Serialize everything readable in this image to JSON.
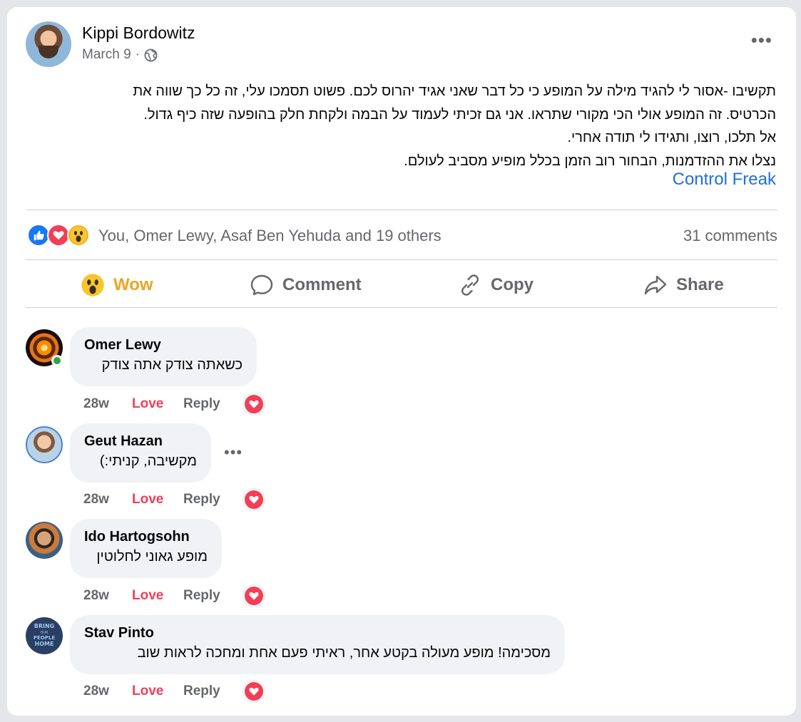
{
  "post": {
    "author": "Kippi Bordowitz",
    "date": "March 9",
    "separator": "·",
    "lines": [
      "תקשיבו -אסור לי להגיד מילה על המופע כי כל דבר שאני אגיד יהרוס לכם. פשוט תסמכו עלי, זה כל כך שווה את",
      "הכרטיס. זה המופע אולי הכי מקורי שתראו. אני גם זכיתי לעמוד על הבמה ולקחת חלק בהופעה שזה כיף גדול.",
      "אל תלכו, רוצו, ותגידו לי תודה אחרי.",
      "נצלו את ההזדמנות, הבחור רוב הזמן בכלל מופיע מסביב לעולם."
    ],
    "link_text": "Control Freak"
  },
  "reactions": {
    "summary": "You, Omer Lewy, Asaf Ben Yehuda and 19 others",
    "comments_count": "31 comments"
  },
  "actions": {
    "wow": "Wow",
    "comment": "Comment",
    "copy": "Copy",
    "share": "Share"
  },
  "comments": [
    {
      "name": "Omer Lewy",
      "text": "כשאתה צודק אתה צודק",
      "time": "28w",
      "love": "Love",
      "reply": "Reply"
    },
    {
      "name": "Geut Hazan",
      "text": "מקשיבה, קניתי:)",
      "time": "28w",
      "love": "Love",
      "reply": "Reply"
    },
    {
      "name": "Ido Hartogsohn",
      "text": "מופע גאוני לחלוטין",
      "time": "28w",
      "love": "Love",
      "reply": "Reply"
    },
    {
      "name": "Stav Pinto",
      "text": "מסכימה! מופע מעולה בקטע אחר, ראיתי פעם אחת ומחכה לראות שוב",
      "time": "28w",
      "love": "Love",
      "reply": "Reply"
    }
  ],
  "avatar_texts": {
    "stav": [
      "BRING",
      "OUR",
      "PEOPLE",
      "HOME"
    ]
  },
  "colors": {
    "link": "#216fdb",
    "wow_active": "#e9a524",
    "love": "#f33e58",
    "like": "#1877f2",
    "secondary_text": "#65676b",
    "bubble": "#f0f2f5"
  },
  "icons": [
    "globe-icon",
    "more-icon",
    "like-reaction-icon",
    "love-reaction-icon",
    "wow-reaction-icon",
    "comment-icon",
    "link-icon",
    "share-icon",
    "heart-icon"
  ]
}
